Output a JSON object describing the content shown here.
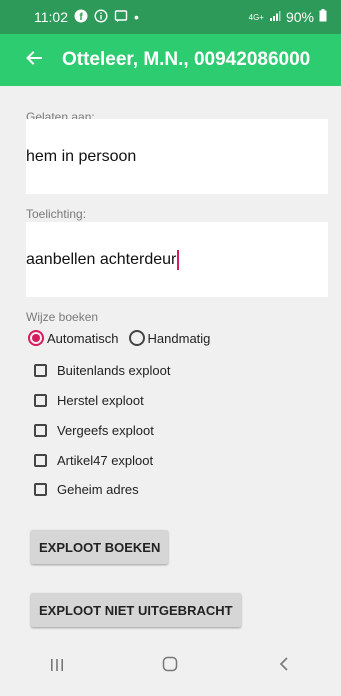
{
  "status_bar": {
    "time": "11:02",
    "left_icons": [
      "facebook-icon",
      "info-icon",
      "message-icon"
    ],
    "dot": "•",
    "network": "4G+",
    "battery": "90%"
  },
  "app_bar": {
    "title": "Otteleer, M.N., 00942086000"
  },
  "form": {
    "gelaten_label": "Gelaten aan:",
    "gelaten_value": "hem in persoon",
    "toelichting_label": "Toelichting:",
    "toelichting_value": "aanbellen achterdeur",
    "wijze_label": "Wijze boeken",
    "radio_options": [
      {
        "label": "Automatisch",
        "checked": true
      },
      {
        "label": "Handmatig",
        "checked": false
      }
    ],
    "checkboxes": [
      {
        "label": "Buitenlands exploot",
        "checked": false
      },
      {
        "label": "Herstel exploot",
        "checked": false
      },
      {
        "label": "Vergeefs exploot",
        "checked": false
      },
      {
        "label": "Artikel47 exploot",
        "checked": false
      },
      {
        "label": "Geheim adres",
        "checked": false
      }
    ]
  },
  "buttons": {
    "boeken": "EXPLOOT BOEKEN",
    "niet_uitgebracht": "EXPLOOT NIET UITGEBRACHT"
  },
  "colors": {
    "app_bar": "#2ecc71",
    "status_bar": "#2e9a59",
    "accent": "#d81b60"
  }
}
